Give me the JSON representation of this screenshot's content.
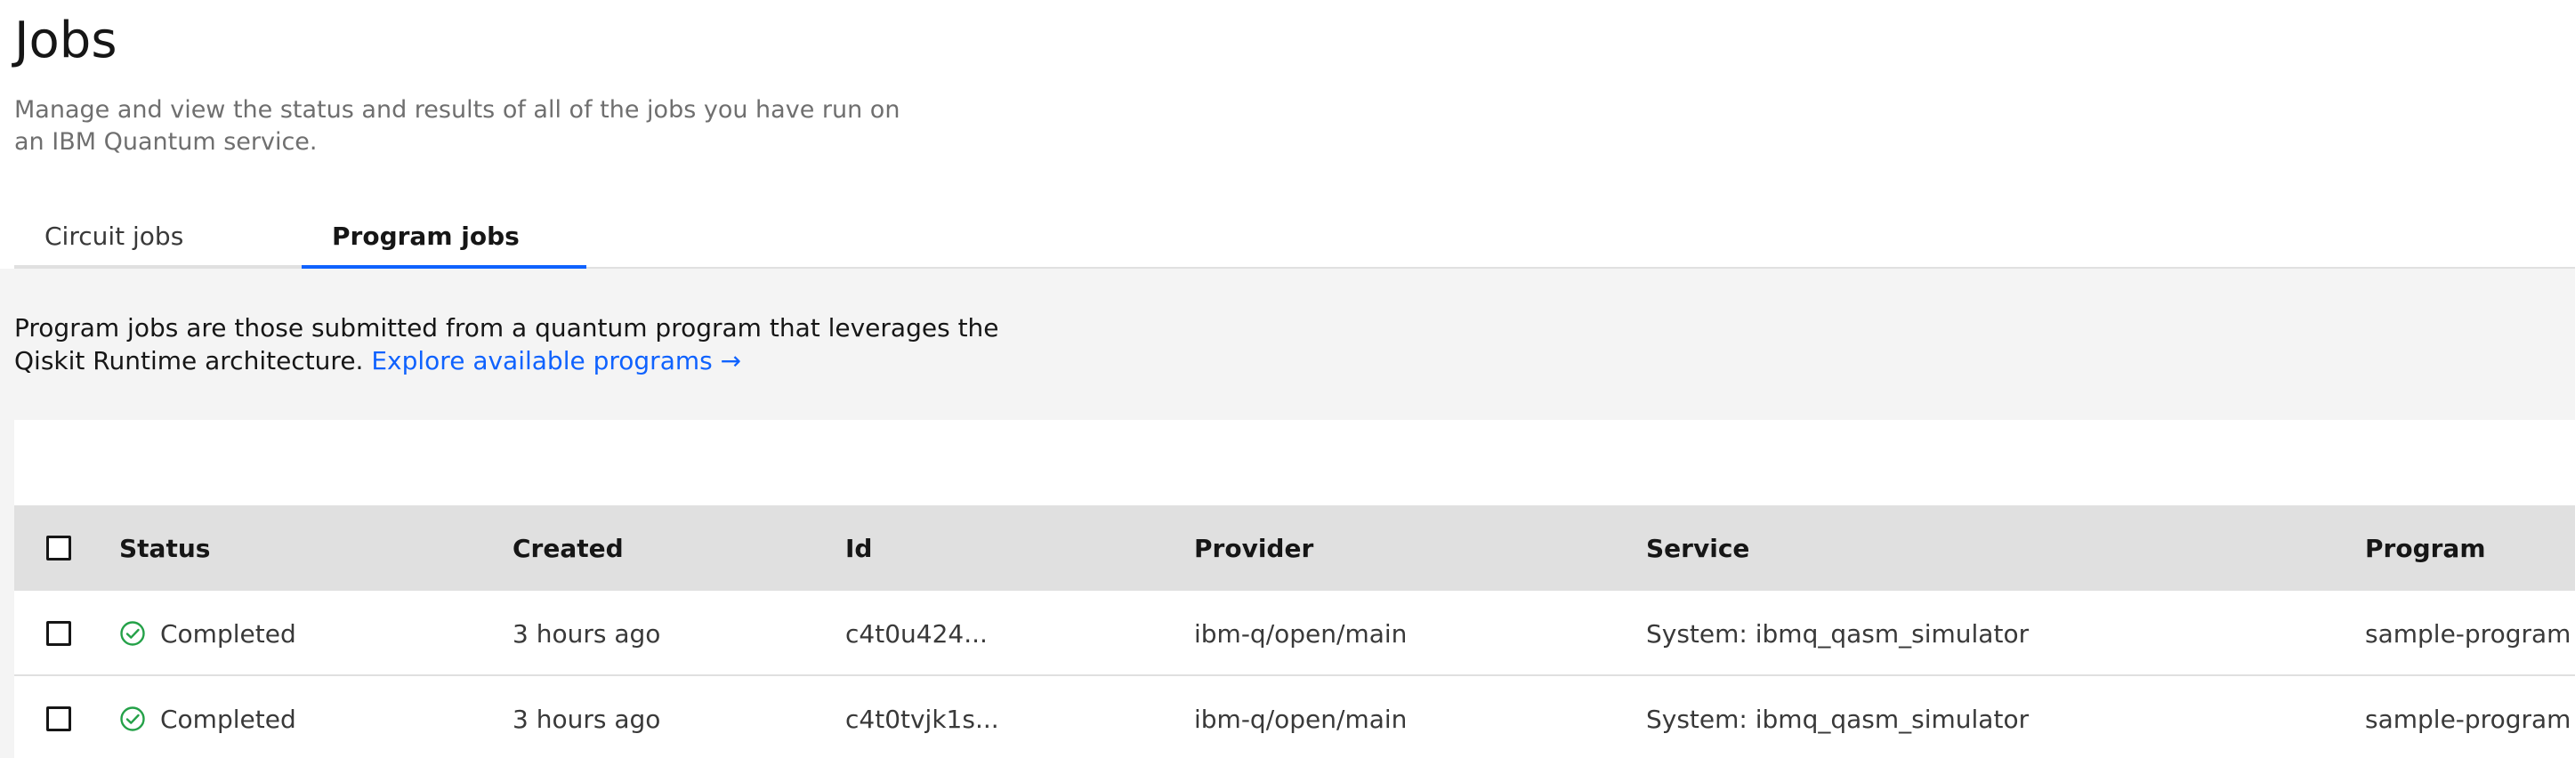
{
  "header": {
    "title": "Jobs",
    "subtitle": "Manage and view the status and results of all of the jobs you have run on an IBM Quantum service."
  },
  "tabs": [
    {
      "label": "Circuit jobs",
      "selected": false
    },
    {
      "label": "Program jobs",
      "selected": true
    }
  ],
  "description": {
    "text": "Program jobs are those submitted from a quantum program that leverages the Qiskit Runtime architecture. ",
    "link_label": "Explore available programs →"
  },
  "table": {
    "columns": {
      "status": "Status",
      "created": "Created",
      "id": "Id",
      "provider": "Provider",
      "service": "Service",
      "program": "Program"
    },
    "rows": [
      {
        "status": "Completed",
        "status_icon": "checkmark-outline-icon",
        "created": "3 hours ago",
        "id": "c4t0u424...",
        "provider": "ibm-q/open/main",
        "service": "System: ibmq_qasm_simulator",
        "program": "sample-program"
      },
      {
        "status": "Completed",
        "status_icon": "checkmark-outline-icon",
        "created": "3 hours ago",
        "id": "c4t0tvjk1s...",
        "provider": "ibm-q/open/main",
        "service": "System: ibmq_qasm_simulator",
        "program": "sample-program"
      }
    ]
  },
  "colors": {
    "accent": "#0f62fe",
    "success": "#24a148",
    "band_background": "#f4f4f4",
    "header_row_background": "#e0e0e0"
  }
}
